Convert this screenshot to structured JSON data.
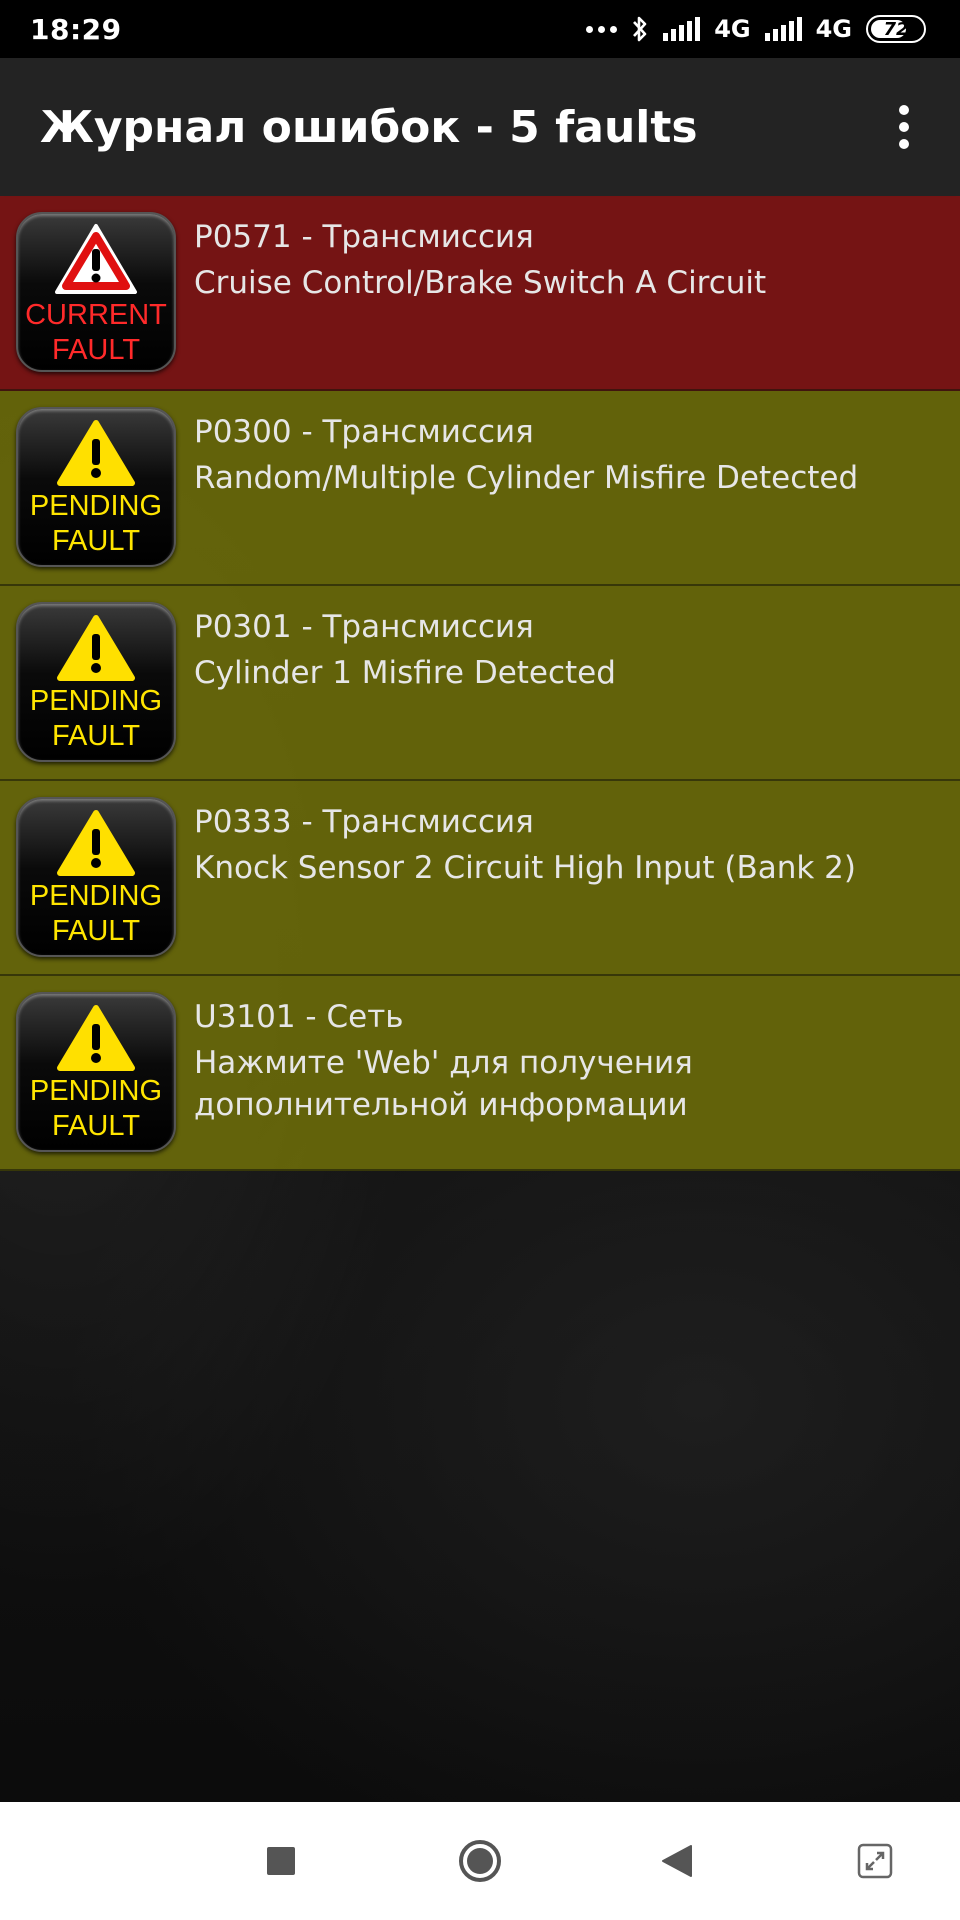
{
  "status_bar": {
    "time": "18:29",
    "network_1": "4G",
    "network_2": "4G",
    "battery": "72",
    "battery_level": 0.72
  },
  "app_bar": {
    "title": "Журнал ошибок - 5 faults",
    "menu_icon": "more-vert-icon"
  },
  "faults": [
    {
      "status": "current",
      "badge_line1": "CURRENT",
      "badge_line2": "FAULT",
      "code": "P0571 - Трансмиссия",
      "description": "Cruise Control/Brake Switch A Circuit"
    },
    {
      "status": "pending",
      "badge_line1": "PENDING",
      "badge_line2": "FAULT",
      "code": "P0300 - Трансмиссия",
      "description": "Random/Multiple Cylinder Misfire Detected"
    },
    {
      "status": "pending",
      "badge_line1": "PENDING",
      "badge_line2": "FAULT",
      "code": "P0301 - Трансмиссия",
      "description": "Cylinder 1 Misfire Detected"
    },
    {
      "status": "pending",
      "badge_line1": "PENDING",
      "badge_line2": "FAULT",
      "code": "P0333 - Трансмиссия",
      "description": "Knock Sensor 2 Circuit High Input (Bank 2)"
    },
    {
      "status": "pending",
      "badge_line1": "PENDING",
      "badge_line2": "FAULT",
      "code": "U3101 - Сеть",
      "description": "Нажмите 'Web' для получения\nдополнительной информации"
    }
  ],
  "colors": {
    "current_row": "#7d1414",
    "pending_row": "#69690a",
    "current_badge_text": "#ff2a2a",
    "pending_badge_text": "#ffe500"
  },
  "nav_bar": {
    "buttons": [
      "recents-square-icon",
      "home-circle-icon",
      "back-triangle-icon",
      "screen-expand-icon"
    ]
  }
}
